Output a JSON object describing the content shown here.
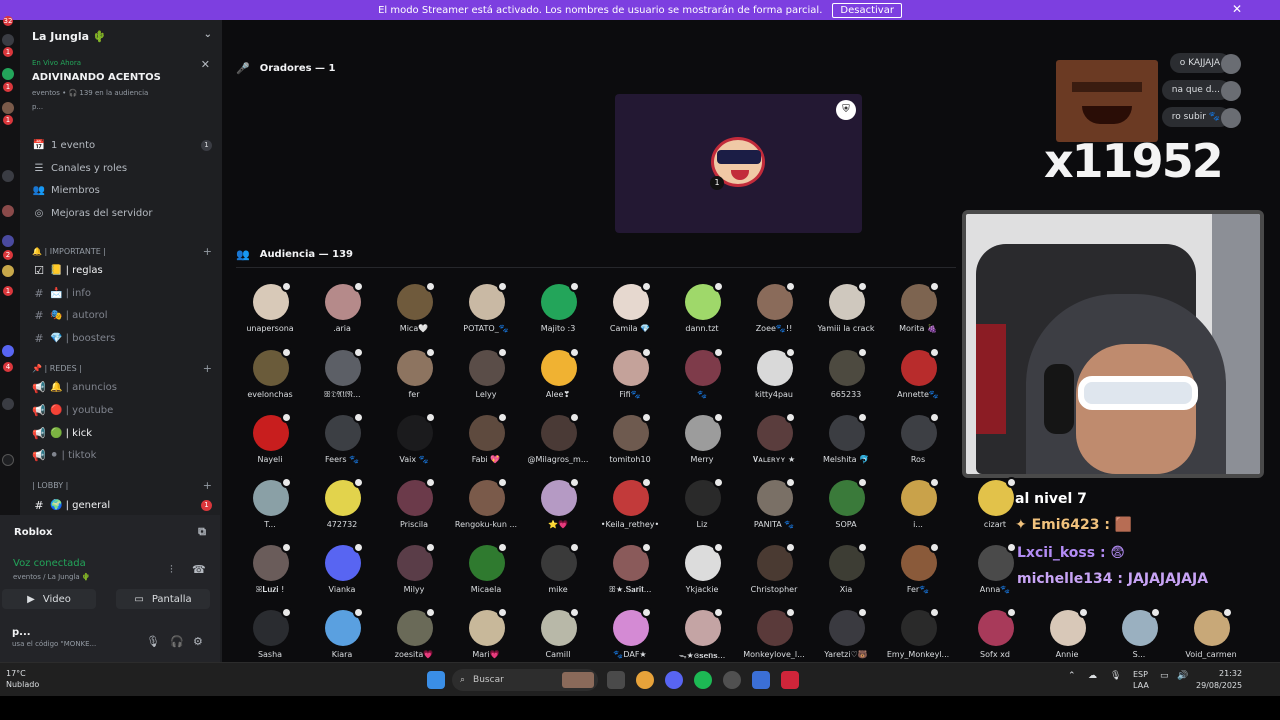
{
  "banner": {
    "message": "El modo Streamer está activado. Los nombres de usuario se mostrarán de forma parcial.",
    "deactivate": "Desactivar"
  },
  "rail_badges": [
    "32",
    "1",
    "1",
    "1",
    "2",
    "1",
    "4",
    "1"
  ],
  "server": {
    "name": "La Jungla 🌵"
  },
  "live": {
    "tag": "En Vivo Ahora",
    "title": "ADIVINANDO ACENTOS",
    "meta": "eventos • 🎧 139 en la audiencia",
    "participants": "p..."
  },
  "nav": [
    {
      "icon": "📅",
      "label": "1 evento",
      "count": "1"
    },
    {
      "icon": "☰",
      "label": "Canales y roles"
    },
    {
      "icon": "👥",
      "label": "Miembros"
    },
    {
      "icon": "◎",
      "label": "Mejoras del servidor"
    }
  ],
  "categories": {
    "importante": "🔔 | IMPORTANTE |",
    "redes": "📌 | REDES |",
    "lobby": "| LOBBY |"
  },
  "channels": {
    "reglas": "📒 | reglas",
    "info": "📩 | info",
    "autorol": "🎭 | autorol",
    "boosters": "💎 | boosters",
    "anuncios": "🔔 | anuncios",
    "youtube": "🔴 | youtube",
    "kick": "🟢 | kick",
    "tiktok": "⚫ | tiktok",
    "general": "🌍 | general",
    "general_badge": "1"
  },
  "roblox": "Roblox",
  "voice": {
    "status": "Voz conectada",
    "sub": "eventos / La Jungla 🌵",
    "video": "Video",
    "screen": "Pantalla"
  },
  "user": {
    "name": "p...",
    "status": "usa el código \"MONKE..."
  },
  "stage": {
    "speakers": "Oradores — 1",
    "audience": "Audiencia — 139"
  },
  "audience": [
    {
      "name": "unapersona",
      "color": "#d8c9b8"
    },
    {
      "name": ".aria",
      "color": "#b58a8a"
    },
    {
      "name": "Mica🤍",
      "color": "#6f5a3c"
    },
    {
      "name": "POTATO_🐾",
      "color": "#c9b9a4"
    },
    {
      "name": "Majito :3",
      "color": "#23a55a"
    },
    {
      "name": "Camila 💎",
      "color": "#e6d8cf"
    },
    {
      "name": "dann.tzt",
      "color": "#9fd86a"
    },
    {
      "name": "Zoee🐾!!",
      "color": "#8a6b5a"
    },
    {
      "name": "Yamiii la crack",
      "color": "#cfc8be"
    },
    {
      "name": "Morita 🍇",
      "color": "#7d6450"
    },
    {
      "name": "evelonchas",
      "color": "#6a5b3a"
    },
    {
      "name": "ꕥ𝔇𝔄𝔘𝔑...",
      "color": "#5c5f66"
    },
    {
      "name": "fer",
      "color": "#8d7460"
    },
    {
      "name": "Lelyy",
      "color": "#5a4d48"
    },
    {
      "name": "Alee❣",
      "color": "#f0b232"
    },
    {
      "name": "Fifi🐾",
      "color": "#c4a29a"
    },
    {
      "name": "🐾",
      "color": "#7e3b4a"
    },
    {
      "name": "kitty4pau",
      "color": "#d9d9d9"
    },
    {
      "name": "665233",
      "color": "#4d4a40"
    },
    {
      "name": "Annette🐾",
      "color": "#b82c2c"
    },
    {
      "name": "Nayeli",
      "color": "#c81e1e"
    },
    {
      "name": "Feers 🐾",
      "color": "#3c3f44"
    },
    {
      "name": "Vaix 🐾",
      "color": "#1b1b1d"
    },
    {
      "name": "Fabi 💖",
      "color": "#5e4a3e"
    },
    {
      "name": "@Milagros_m...",
      "color": "#4a3a36"
    },
    {
      "name": "tomitoh10",
      "color": "#6e5a4f"
    },
    {
      "name": "Merry",
      "color": "#9c9c9c"
    },
    {
      "name": "𝐕ᴀʟᴇʀʏʏ ★",
      "color": "#5a3d3d"
    },
    {
      "name": "Melshita 🐬",
      "color": "#3b3d42"
    },
    {
      "name": "Ros",
      "color": "#3d3f44"
    },
    {
      "name": "T...",
      "color": "#8aa0a6"
    },
    {
      "name": "472732",
      "color": "#e2d34c"
    },
    {
      "name": "Priscila",
      "color": "#6b3a4a"
    },
    {
      "name": "Rengoku-kun ...",
      "color": "#7a5a4a"
    },
    {
      "name": "⭐💗",
      "color": "#b59ac4"
    },
    {
      "name": "•Keila_rethey•",
      "color": "#c23a3a"
    },
    {
      "name": "Liz",
      "color": "#2a2a2a"
    },
    {
      "name": "PANITA 🐾",
      "color": "#7a7066"
    },
    {
      "name": "SOPA",
      "color": "#3a7a3a"
    },
    {
      "name": "i...",
      "color": "#c9a24a"
    },
    {
      "name": "ꕤ𝐋𝐮𝐳𝐢 !",
      "color": "#6a5c5a"
    },
    {
      "name": "Vianka",
      "color": "#5865f2"
    },
    {
      "name": "Milyy",
      "color": "#5a3d48"
    },
    {
      "name": "Micaela",
      "color": "#2f7a2f"
    },
    {
      "name": "mike",
      "color": "#3a3a3a"
    },
    {
      "name": "ꕥ★.𝐒𝐚𝐫𝐢𝐭...",
      "color": "#8a5a5a"
    },
    {
      "name": "Ykjackie",
      "color": "#dcdcdc"
    },
    {
      "name": "Christopher",
      "color": "#4a3a32"
    },
    {
      "name": "Xia",
      "color": "#3d3d34"
    },
    {
      "name": "Fer🐾",
      "color": "#8a5a3a"
    },
    {
      "name": "Sasha",
      "color": "#2a2c30"
    },
    {
      "name": "Kiara",
      "color": "#5aa0e0"
    },
    {
      "name": "zoesita💗",
      "color": "#6a6a58"
    },
    {
      "name": "Mari💗",
      "color": "#c8b89a"
    },
    {
      "name": "Camill",
      "color": "#b8b8a8"
    },
    {
      "name": "🐾DAF★",
      "color": "#d48ad4"
    },
    {
      "name": "ᯓ★ɞ𝐬𝐞𝐧𝐬...",
      "color": "#c4a4a4"
    },
    {
      "name": "Monkeylove_l...",
      "color": "#5a3a3a"
    },
    {
      "name": "Yaretzi♡🐻",
      "color": "#3a3a40"
    },
    {
      "name": "Emy_Monkeyl...",
      "color": "#2a2a2a"
    }
  ],
  "chat_preview": [
    "o KAJJAJA",
    "na que d...",
    "ro subir 🐾"
  ],
  "emote_text": "x11952",
  "overlay_chat": [
    {
      "text": "al nivel 7",
      "color": "#ffffff"
    },
    {
      "text": "✦ Emi6423 : 🟫",
      "color": "#f1c27d"
    },
    {
      "text": "Lxcii_koss : 😨",
      "color": "#b38cf5"
    },
    {
      "text": "michelle134 : JAJAJAJAJA",
      "color": "#c8a4f5"
    }
  ],
  "right_users": [
    {
      "name": "cizart",
      "color": "#e2c24a"
    },
    {
      "name": "Anna🐾",
      "color": "#4a4a4a"
    },
    {
      "name": "Sofx xd",
      "color": "#a83a5a"
    },
    {
      "name": "Annie",
      "color": "#d8c8b8"
    },
    {
      "name": "S...",
      "color": "#9ab0c0"
    },
    {
      "name": "Void_carmen",
      "color": "#c8a878"
    }
  ],
  "taskbar": {
    "weather_temp": "17°C",
    "weather_desc": "Nublado",
    "search": "Buscar",
    "lang": "ESP",
    "lang_sub": "LAA",
    "time": "21:32",
    "date": "29/08/2025"
  }
}
